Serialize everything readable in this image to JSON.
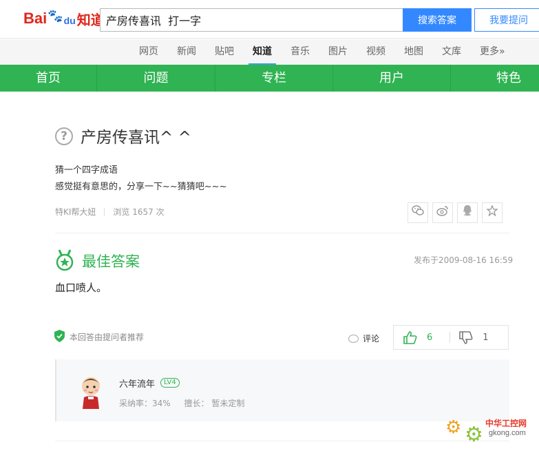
{
  "header": {
    "logo_bai": "Bai",
    "logo_du": "du",
    "logo_zhidao": "知道",
    "search_value": "产房传喜讯  打一字",
    "search_button": "搜索答案",
    "ask_button": "我要提问"
  },
  "subnav": {
    "items": [
      "网页",
      "新闻",
      "贴吧",
      "知道",
      "音乐",
      "图片",
      "视频",
      "地图",
      "文库",
      "更多»"
    ],
    "active": "知道"
  },
  "greennav": {
    "items": [
      "首页",
      "问题",
      "专栏",
      "用户",
      "特色"
    ]
  },
  "question": {
    "icon": "question-mark-icon",
    "title": "产房传喜讯^ ^",
    "description": [
      "猜一个四字成语",
      "感觉挺有意思的，分享一下~~猜猜吧~~~"
    ],
    "asker": "特KI帮大妞",
    "views": "浏览 1657 次"
  },
  "share_icons": [
    "wechat-icon",
    "weibo-icon",
    "qq-icon",
    "favorite-star-icon"
  ],
  "best_answer": {
    "title": "最佳答案",
    "published": "发布于2009-08-16 16:59",
    "content": "血口喷人。",
    "recommended": "本回答由提问者推荐",
    "comment_label": "评论",
    "upvotes": "6",
    "downvotes": "1"
  },
  "user": {
    "name": "六年流年",
    "level": "LV4",
    "adoption_rate": "采纳率：34%",
    "specialty": "擅长：  暂未定制"
  },
  "watermark": {
    "cn": "中华工控网",
    "en": "gkong.com"
  },
  "colors": {
    "green": "#30b353",
    "blue": "#3388ff",
    "baidu_red": "#e1251b"
  }
}
